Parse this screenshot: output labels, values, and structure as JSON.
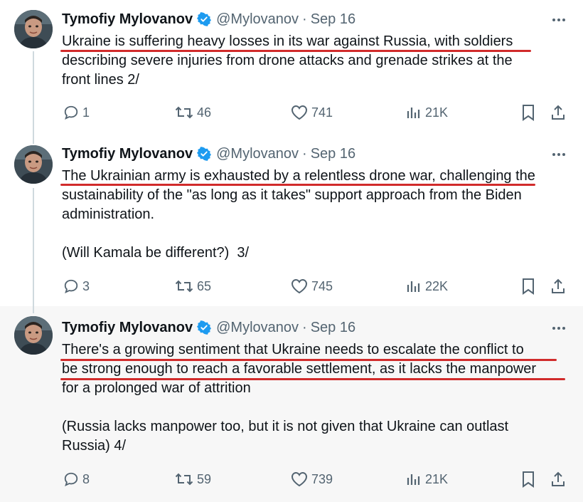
{
  "author": {
    "name": "Tymofiy Mylovanov",
    "handle": "@Mylovanov",
    "separator": "·",
    "verified_color": "#1d9bf0"
  },
  "accent_underline_color": "#d12b2b",
  "tweets": [
    {
      "date": "Sep 16",
      "lines": [
        "Ukraine is suffering heavy losses in its war against Russia, with soldiers",
        "describing severe injuries from drone attacks and grenade strikes at the",
        "front lines 2/"
      ],
      "replies": "1",
      "reposts": "46",
      "likes": "741",
      "views": "21K"
    },
    {
      "date": "Sep 16",
      "lines": [
        "The Ukrainian army is exhausted by a relentless drone war, challenging the",
        "sustainability of the \"as long as it takes\" support approach from the Biden",
        "administration.",
        "",
        "(Will Kamala be different?)  3/"
      ],
      "replies": "3",
      "reposts": "65",
      "likes": "745",
      "views": "22K"
    },
    {
      "date": "Sep 16",
      "lines": [
        "There's a growing sentiment that Ukraine needs to escalate the conflict to",
        "be strong enough to reach a favorable settlement, as it lacks the manpower",
        "for a prolonged war of attrition",
        "",
        "(Russia lacks manpower too, but it is not given that Ukraine can outlast",
        "Russia) 4/"
      ],
      "replies": "8",
      "reposts": "59",
      "likes": "739",
      "views": "21K"
    }
  ],
  "icons": {
    "more": "more-icon",
    "reply": "reply-icon",
    "repost": "repost-icon",
    "like": "heart-icon",
    "views": "views-icon",
    "bookmark": "bookmark-icon",
    "share": "share-icon",
    "verified": "verified-badge-icon"
  }
}
